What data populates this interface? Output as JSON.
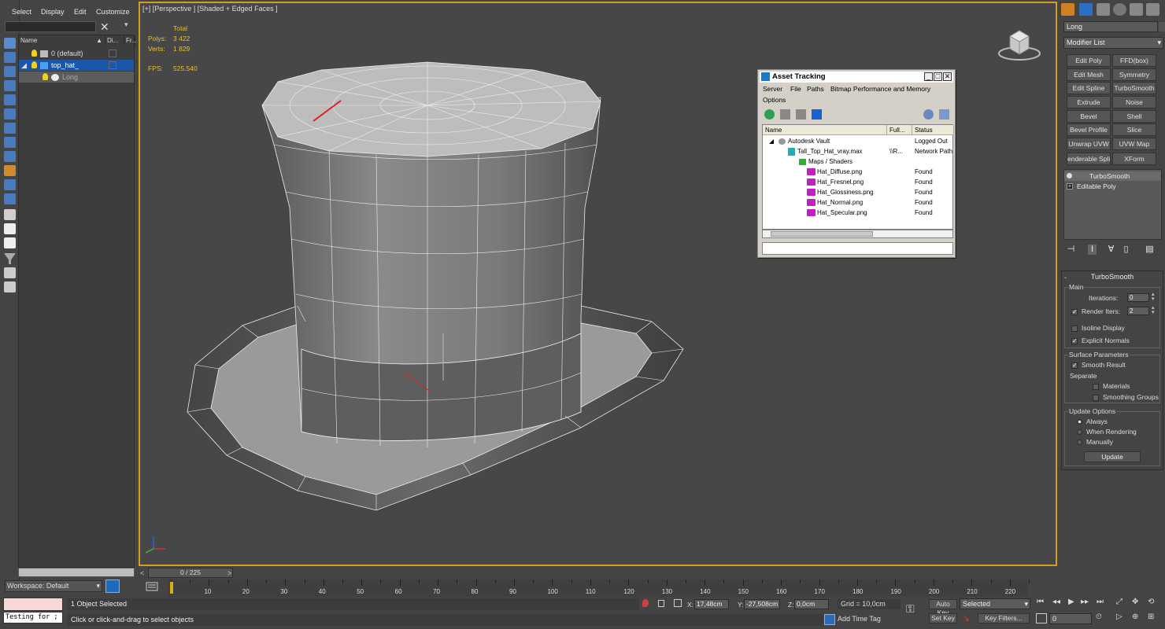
{
  "explorer": {
    "menu": [
      "Select",
      "Display",
      "Edit",
      "Customize"
    ],
    "columns": [
      "Name",
      "Di...",
      "Fr..."
    ],
    "rows": [
      {
        "name": "0 (default)"
      },
      {
        "name": "top_hat_"
      },
      {
        "name": "Long"
      }
    ],
    "workspace": "Workspace: Default"
  },
  "viewport": {
    "label": "[+] [Perspective ] [Shaded + Edged Faces ]",
    "stats": {
      "total_label": "Total",
      "polys_label": "Polys:",
      "polys": "3 422",
      "verts_label": "Verts:",
      "verts": "1 829",
      "fps_label": "FPS:",
      "fps": "525.540"
    }
  },
  "asset_tracking": {
    "title": "Asset Tracking",
    "menu": [
      "Server",
      "File",
      "Paths",
      "Bitmap Performance and Memory",
      "Options"
    ],
    "columns": [
      "Name",
      "Full...",
      "Status"
    ],
    "rows": [
      {
        "name": "Autodesk Vault",
        "path": "",
        "status": "Logged Out",
        "icon": "vault-icon"
      },
      {
        "name": "Tall_Top_Hat_vray.max",
        "path": "\\\\R...",
        "status": "Network Path",
        "icon": "max-file-icon"
      },
      {
        "name": "Maps / Shaders",
        "path": "",
        "status": "",
        "icon": "maps-folder-icon"
      },
      {
        "name": "Hat_Diffuse.png",
        "path": "",
        "status": "Found",
        "icon": "png-icon"
      },
      {
        "name": "Hat_Fresnel.png",
        "path": "",
        "status": "Found",
        "icon": "png-icon"
      },
      {
        "name": "Hat_Glossiness.png",
        "path": "",
        "status": "Found",
        "icon": "png-icon"
      },
      {
        "name": "Hat_Normal.png",
        "path": "",
        "status": "Found",
        "icon": "png-icon"
      },
      {
        "name": "Hat_Specular.png",
        "path": "",
        "status": "Found",
        "icon": "png-icon"
      }
    ]
  },
  "command_panel": {
    "object_name": "Long",
    "modifier_list": "Modifier List",
    "modifier_buttons": [
      "Edit Poly",
      "FFD(box)",
      "Edit Mesh",
      "Symmetry",
      "Edit Spline",
      "TurboSmooth",
      "Extrude",
      "Noise",
      "Bevel",
      "Shell",
      "Bevel Profile",
      "Slice",
      "Unwrap UVW",
      "UVW Map",
      "enderable Splin",
      "XForm"
    ],
    "stack": [
      "TurboSmooth",
      "Editable Poly"
    ],
    "turbosmooth": {
      "title": "TurboSmooth",
      "main": "Main",
      "iterations_label": "Iterations:",
      "iterations": "0",
      "render_iters_label": "Render Iters:",
      "render_iters": "2",
      "render_iters_checked": true,
      "isoline_label": "Isoline Display",
      "isoline_checked": false,
      "explicit_label": "Explicit Normals",
      "explicit_checked": true,
      "surface_params": "Surface Parameters",
      "smooth_result_label": "Smooth Result",
      "smooth_result_checked": true,
      "separate": "Separate",
      "materials_label": "Materials",
      "materials_checked": false,
      "smoothing_groups_label": "Smoothing Groups",
      "smoothing_groups_checked": false,
      "update_options": "Update Options",
      "always": "Always",
      "when_rendering": "When Rendering",
      "manually": "Manually",
      "update_selected": "Always",
      "update_button": "Update"
    }
  },
  "timeline": {
    "slider": "0 / 225",
    "ticks": [
      "10",
      "20",
      "30",
      "40",
      "50",
      "60",
      "70",
      "80",
      "90",
      "100",
      "110",
      "120",
      "130",
      "140",
      "150",
      "160",
      "170",
      "180",
      "190",
      "200",
      "210",
      "220"
    ]
  },
  "status": {
    "listener": "Testing for ;",
    "selection": "1 Object Selected",
    "prompt": "Click or click-and-drag to select objects",
    "x_label": "X:",
    "x": "17,48cm",
    "y_label": "Y:",
    "y": "-27,508cm",
    "z_label": "Z:",
    "z": "0,0cm",
    "grid": "Grid = 10,0cm",
    "add_time_tag": "Add Time Tag",
    "auto_key": "Auto Key",
    "set_key": "Set Key",
    "selected": "Selected",
    "key_filters": "Key Filters...",
    "frame": "0"
  },
  "colors": {
    "viewport_border": "#d0a020",
    "stats": "#e8c030",
    "selection_highlight": "#1c56a8",
    "time_cursor": "#d4b020"
  }
}
